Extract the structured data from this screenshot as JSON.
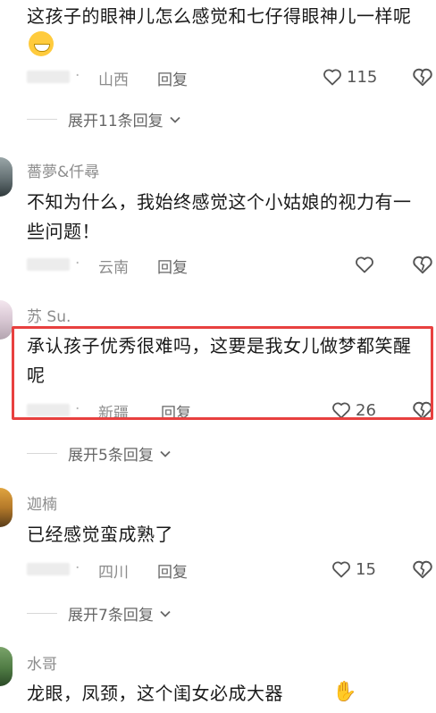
{
  "comments": [
    {
      "text": "这孩子的眼神儿怎么感觉和七仔得眼神儿一样呢",
      "location": "山西",
      "reply": "回复",
      "likes": "115",
      "expand": "展开11条回复"
    },
    {
      "username": "薔夢&仟尋",
      "text": "不知为什么，我始终感觉这个小姑娘的视力有一些问题！",
      "location": "云南",
      "reply": "回复"
    },
    {
      "username": "苏 Su.",
      "text": "承认孩子优秀很难吗，这要是我女儿做梦都笑醒呢",
      "location": "新疆",
      "reply": "回复",
      "likes": "26",
      "expand": "展开5条回复"
    },
    {
      "username": "迦楠",
      "text": "已经感觉蛮成熟了",
      "location": "四川",
      "reply": "回复",
      "likes": "15",
      "expand": "展开7条回复"
    },
    {
      "username": "水哥",
      "text": "龙眼，凤颈，这个闺女必成大器"
    }
  ],
  "colors": {
    "highlight": "#e8403f",
    "text": "#1a1a1a",
    "meta": "#8c8c8c"
  },
  "icons": {
    "like": "heart-outline-icon",
    "dislike": "broken-heart-icon",
    "expand": "chevron-down-icon"
  }
}
